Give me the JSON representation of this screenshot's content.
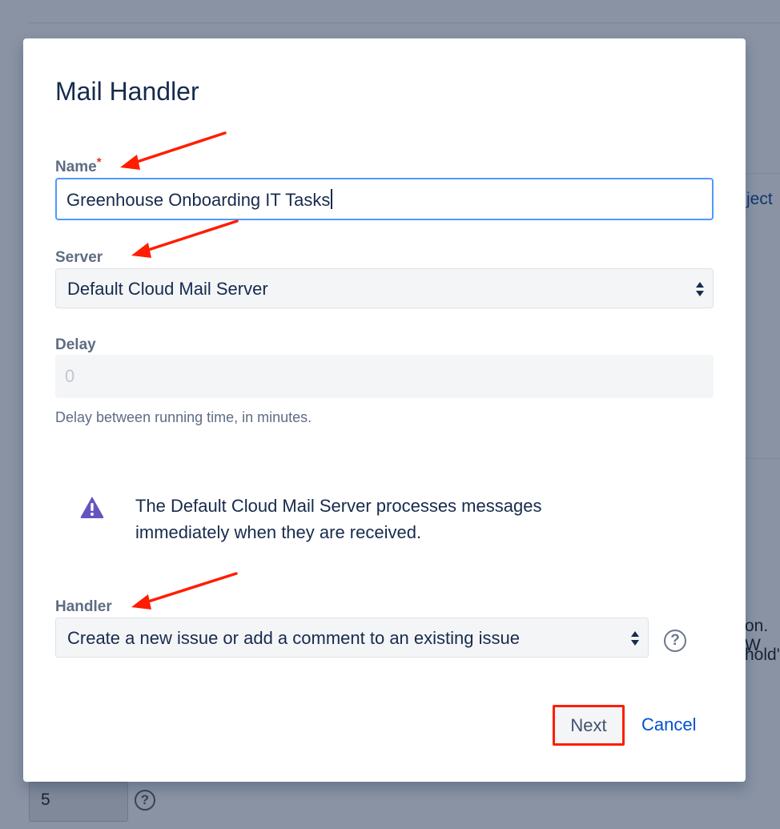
{
  "background": {
    "link_fragment": "ject",
    "text_fragment_1": "on. W",
    "text_fragment_2": "hold'",
    "input_value": "5",
    "help_glyph": "?"
  },
  "dialog": {
    "title": "Mail Handler",
    "name": {
      "label": "Name",
      "required_mark": "*",
      "value": "Greenhouse Onboarding IT Tasks"
    },
    "server": {
      "label": "Server",
      "selected": "Default Cloud Mail Server"
    },
    "delay": {
      "label": "Delay",
      "placeholder": "0",
      "hint": "Delay between running time, in minutes."
    },
    "warning": {
      "icon": "warning-icon",
      "text": "The Default Cloud Mail Server processes messages immediately when they are received."
    },
    "handler": {
      "label": "Handler",
      "selected": "Create a new issue or add a comment to an existing issue",
      "help_glyph": "?"
    },
    "buttons": {
      "next": "Next",
      "cancel": "Cancel"
    }
  },
  "colors": {
    "overlay": "#8993a4",
    "focus_border": "#4c9aff",
    "required": "#de350b",
    "link": "#0052cc",
    "warning_icon": "#6554c0",
    "annotation": "#ff1d00"
  }
}
